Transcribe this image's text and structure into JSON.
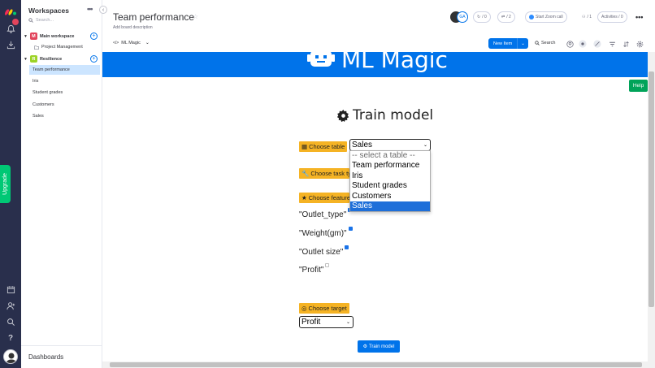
{
  "sidebar": {
    "title": "Workspaces",
    "search_placeholder": "Search...",
    "workspaces": [
      {
        "initial": "M",
        "name": "Main workspace",
        "color": "#e2445c",
        "boards": [
          "Project Management"
        ]
      },
      {
        "initial": "R",
        "name": "Resilience",
        "color": "#9cd326",
        "boards": [
          "Team performance",
          "Iris",
          "Student grades",
          "Customers",
          "Sales"
        ]
      }
    ],
    "selected_board": "Team performance",
    "footer": "Dashboards"
  },
  "leftbar": {
    "upgrade_label": "Upgrade"
  },
  "header": {
    "board_title": "Team performance",
    "board_description": "Add board description",
    "avatar_initials": "GA",
    "updates_count": "/ 0",
    "invites_count": "/ 2",
    "zoom_label": "Start Zoom call",
    "members_count": "/ 1",
    "activities_label": "Activities / 0",
    "view_tab": "ML Magic",
    "new_item_label": "New Item",
    "search_label": "Search"
  },
  "app": {
    "banner_title": "ML Magic",
    "help_label": "Help",
    "train_title": "Train model",
    "choose_table_label": "Choose table",
    "table_selected": "Sales",
    "table_options": [
      "-- select a table --",
      "Team performance",
      "Iris",
      "Student grades",
      "Customers",
      "Sales"
    ],
    "task_label": "Choose task ty",
    "features_label": "Choose feature",
    "features": [
      {
        "name": "\"Outlet_type\"",
        "checked": true
      },
      {
        "name": "\"Weight(gm)\"",
        "checked": true
      },
      {
        "name": "\"Outlet size\"",
        "checked": true
      },
      {
        "name": "\"Profit\"",
        "checked": false
      }
    ],
    "target_label": "Choose target",
    "target_selected": "Profit",
    "train_button": "Train model"
  },
  "colors": {
    "accent": "#0073ea",
    "tag": "#f5b324",
    "help": "#00a359",
    "upgrade": "#00c875",
    "leftbar": "#292f4c"
  }
}
